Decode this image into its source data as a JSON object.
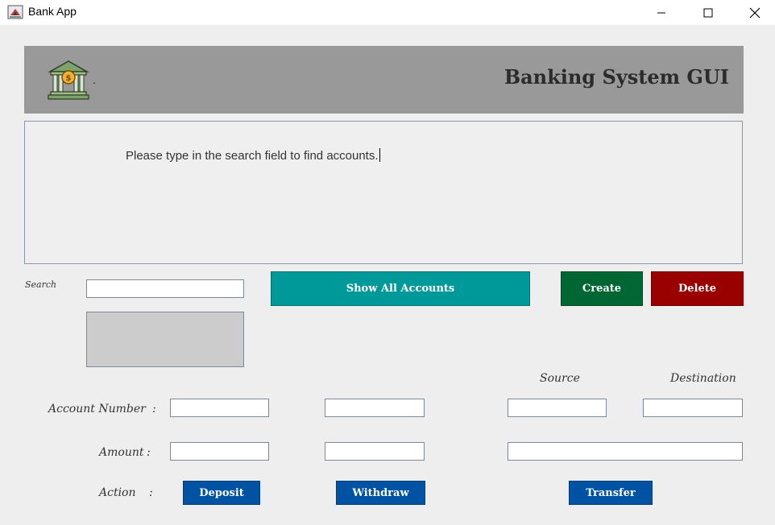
{
  "window": {
    "title": "Bank App",
    "controls": {
      "minimize": "minimize-icon",
      "maximize": "maximize-icon",
      "close": "close-icon"
    }
  },
  "header": {
    "title": "Banking System GUI",
    "icon": "bank-icon",
    "dot": "."
  },
  "output": {
    "message": "Please type in the search field to find accounts."
  },
  "search": {
    "label": "Search",
    "value": ""
  },
  "buttons": {
    "show_all": "Show All Accounts",
    "create": "Create",
    "delete": "Delete",
    "deposit": "Deposit",
    "withdraw": "Withdraw",
    "transfer": "Transfer"
  },
  "form": {
    "source_label": "Source",
    "destination_label": "Destination",
    "account_number_label": "Account Number",
    "amount_label": "Amount",
    "action_label": "Action",
    "colon": ":",
    "deposit_account": "",
    "withdraw_account": "",
    "transfer_source": "",
    "transfer_destination": "",
    "deposit_amount": "",
    "withdraw_amount": "",
    "transfer_amount": ""
  },
  "colors": {
    "header_bg": "#999999",
    "show_all_bg": "#009999",
    "create_bg": "#006633",
    "delete_bg": "#990000",
    "action_bg": "#0052a3"
  }
}
